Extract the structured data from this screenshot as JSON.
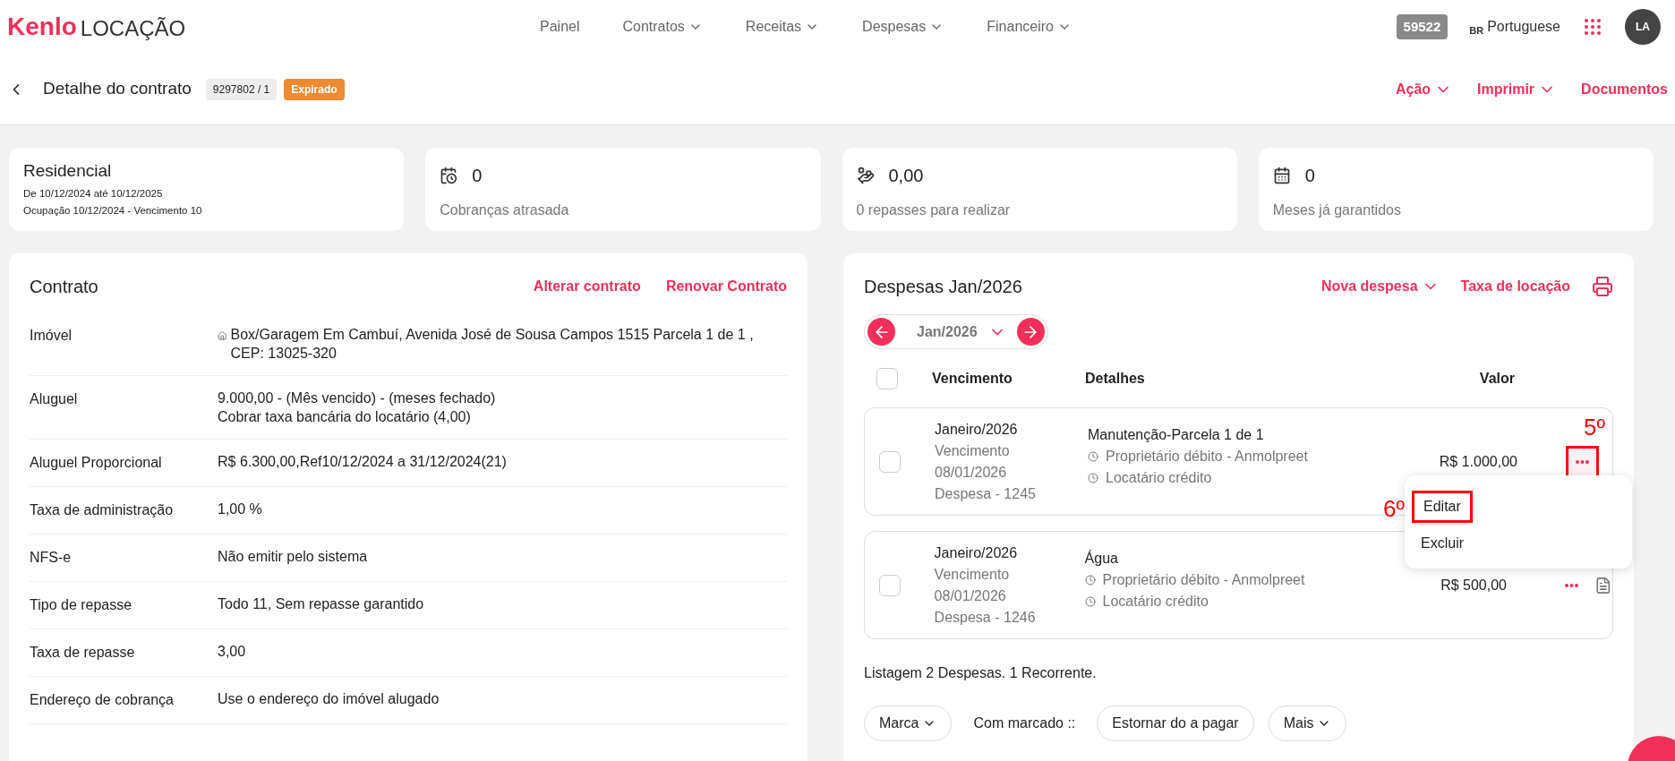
{
  "header": {
    "logo": {
      "brand": "Kenlo",
      "product": "LOCAÇÃO"
    },
    "nav": [
      {
        "label": "Painel",
        "has_menu": false
      },
      {
        "label": "Contratos",
        "has_menu": true
      },
      {
        "label": "Receitas",
        "has_menu": true
      },
      {
        "label": "Despesas",
        "has_menu": true
      },
      {
        "label": "Financeiro",
        "has_menu": true
      }
    ],
    "account_badge": "59522",
    "language": {
      "flag": "BR",
      "label": "Portuguese"
    },
    "avatar": "LA"
  },
  "subheader": {
    "title": "Detalhe do contrato",
    "contract_id": "9297802 / 1",
    "status": "Expirado",
    "actions": [
      {
        "label": "Ação",
        "has_menu": true
      },
      {
        "label": "Imprimir",
        "has_menu": true
      },
      {
        "label": "Documentos",
        "has_menu": false
      }
    ]
  },
  "summary": {
    "type": {
      "title": "Residencial",
      "lines": [
        "De 10/12/2024 até 10/12/2025",
        "Ocupação 10/12/2024 - Vencimento 10"
      ]
    },
    "cards": [
      {
        "kind": "calendar-alert",
        "value": "0",
        "label": "Cobranças atrasada"
      },
      {
        "kind": "money",
        "value": "0,00",
        "label": "0 repasses para realizar"
      },
      {
        "kind": "calendar",
        "value": "0",
        "label": "Meses já garantidos"
      }
    ]
  },
  "contract": {
    "title": "Contrato",
    "actions": [
      "Alterar contrato",
      "Renovar Contrato"
    ],
    "rows": [
      {
        "label": "Imóvel",
        "lines": [
          "Box/Garagem Em Cambuí, Avenida José de Sousa Campos 1515 Parcela 1 de 1 , CEP: 13025-320"
        ],
        "home_icon": true
      },
      {
        "label": "Aluguel",
        "lines": [
          "9.000,00 - (Mês vencido) - (meses fechado)",
          "Cobrar taxa bancária do locatário (4,00)"
        ],
        "home_icon": false
      },
      {
        "label": "Aluguel Proporcional",
        "lines": [
          "R$ 6.300,00,Ref10/12/2024 a 31/12/2024(21)"
        ],
        "home_icon": false
      },
      {
        "label": "Taxa de administração",
        "lines": [
          "1,00 %"
        ],
        "home_icon": false
      },
      {
        "label": "NFS-e",
        "lines": [
          "Não emitir pelo sistema"
        ],
        "home_icon": false
      },
      {
        "label": "Tipo de repasse",
        "lines": [
          "Todo 11, Sem repasse garantido"
        ],
        "home_icon": false
      },
      {
        "label": "Taxa de repasse",
        "lines": [
          "3,00"
        ],
        "home_icon": false
      },
      {
        "label": "Endereço de cobrança",
        "lines": [
          "Use o endereço do imóvel alugado"
        ],
        "home_icon": false
      }
    ]
  },
  "expenses": {
    "title": "Despesas Jan/2026",
    "actions": [
      {
        "label": "Nova despesa",
        "has_menu": true
      },
      {
        "label": "Taxa de locação",
        "has_menu": false
      }
    ],
    "month": "Jan/2026",
    "columns": [
      "Vencimento",
      "Detalhes",
      "Valor"
    ],
    "select_all_checked": false,
    "rows": [
      {
        "checked": false,
        "period": "Janeiro/2026",
        "due_label": "Vencimento",
        "due_date": "08/01/2026",
        "number": "Despesa - 1245",
        "title": "Manutenção-Parcela 1 de 1",
        "parties": [
          "Proprietário débito - Anmolpreet",
          "Locatário crédito"
        ],
        "value": "R$ 1.000,00",
        "menu_open": true,
        "annotation": "5º",
        "doc_icon": false
      },
      {
        "checked": false,
        "period": "Janeiro/2026",
        "due_label": "Vencimento",
        "due_date": "08/01/2026",
        "number": "Despesa - 1246",
        "title": "Água",
        "parties": [
          "Proprietário débito - Anmolpreet",
          "Locatário crédito"
        ],
        "value": "R$ 500,00",
        "menu_open": false,
        "doc_icon": true
      }
    ],
    "menu": [
      {
        "label": "Editar",
        "annotation": "6º"
      },
      {
        "label": "Excluir"
      }
    ],
    "footer_note": "Listagem 2 Despesas. 1 Recorrente.",
    "bulk": {
      "mark_button": "Marca",
      "with_marked": "Com marcado ::",
      "buttons": [
        {
          "label": "Estornar do a pagar",
          "has_menu": false
        },
        {
          "label": "Mais",
          "has_menu": true
        }
      ]
    }
  }
}
